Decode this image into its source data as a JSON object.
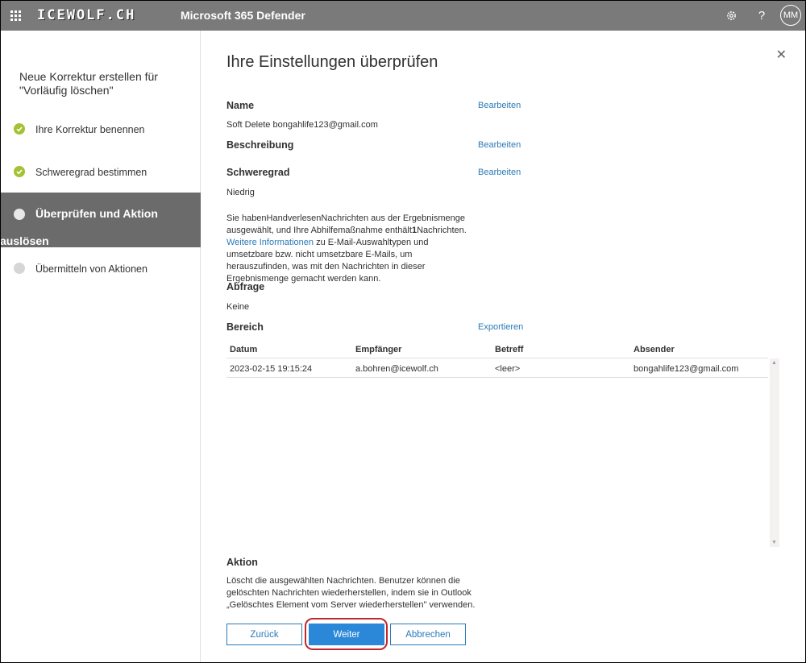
{
  "topbar": {
    "brand": "ICEWOLF.CH",
    "app_title": "Microsoft 365 Defender",
    "avatar": "MM",
    "icons": [
      "waffle-icon",
      "gear-icon",
      "help-icon"
    ]
  },
  "wizard": {
    "title": "Neue Korrektur erstellen für \"Vorläufig löschen\"",
    "steps": [
      {
        "label": "Ihre Korrektur benennen",
        "state": "done"
      },
      {
        "label": "Schweregrad bestimmen",
        "state": "done"
      },
      {
        "label": "Überprüfen und Aktion",
        "label_line2": "auslösen",
        "state": "current"
      },
      {
        "label": "Übermitteln von Aktionen",
        "state": "pending"
      }
    ]
  },
  "main": {
    "title": "Ihre Einstellungen überprüfen",
    "name": {
      "heading": "Name",
      "value": "Soft Delete bongahlife123@gmail.com",
      "edit": "Bearbeiten"
    },
    "description": {
      "heading": "Beschreibung",
      "edit": "Bearbeiten"
    },
    "severity": {
      "heading": "Schweregrad",
      "value": "Niedrig",
      "edit": "Bearbeiten"
    },
    "info": {
      "part1": "Sie habenHandverlesenNachrichten aus der Ergebnismenge ausgewählt, und Ihre Abhilfemaßnahme enthält",
      "count": "1",
      "part2": "Nachrichten.",
      "link": "Weitere Informationen",
      "part3": " zu E-Mail-Auswahltypen und umsetzbare bzw. nicht umsetzbare E-Mails, um herauszufinden, was mit den Nachrichten in dieser Ergebnismenge gemacht werden kann."
    },
    "query": {
      "heading": "Abfrage",
      "value": "Keine"
    },
    "scope": {
      "heading": "Bereich",
      "export": "Exportieren"
    },
    "table": {
      "columns": [
        "Datum",
        "Empfänger",
        "Betreff",
        "Absender"
      ],
      "rows": [
        [
          "2023-02-15 19:15:24",
          "a.bohren@icewolf.ch",
          "<leer>",
          "bongahlife123@gmail.com"
        ]
      ]
    },
    "action": {
      "heading": "Aktion",
      "text": "Löscht die ausgewählten Nachrichten. Benutzer können die gelöschten Nachrichten wiederherstellen, indem sie in Outlook „Gelöschtes Element vom Server wiederherstellen\" verwenden."
    },
    "buttons": {
      "back": "Zurück",
      "next": "Weiter",
      "cancel": "Abbrechen"
    }
  },
  "colors": {
    "accent": "#2b88d8",
    "link": "#2b7ab7",
    "done": "#a4c234",
    "highlight": "#c4262e"
  }
}
